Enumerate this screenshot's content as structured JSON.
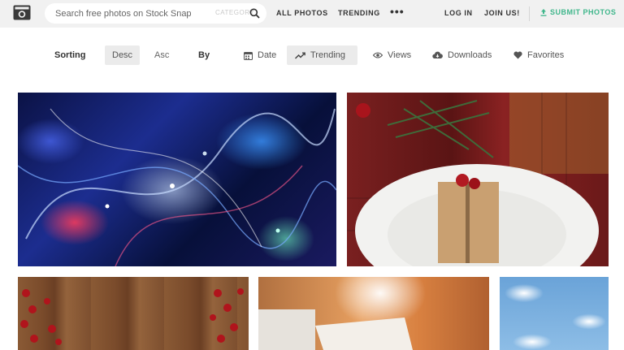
{
  "header": {
    "logo_icon": "camera-icon",
    "search": {
      "placeholder": "Search free photos on Stock Snap",
      "category_label": "CATEGORY"
    },
    "nav": {
      "all_photos": "ALL PHOTOS",
      "trending": "TRENDING",
      "more": "•••",
      "login": "LOG IN",
      "join": "JOIN US!",
      "submit": "SUBMIT PHOTOS"
    }
  },
  "sort": {
    "label": "Sorting",
    "desc": "Desc",
    "asc": "Asc",
    "by": "By",
    "options": [
      {
        "label": "Date",
        "icon": "calendar-icon"
      },
      {
        "label": "Trending",
        "icon": "trending-icon"
      },
      {
        "label": "Views",
        "icon": "eye-icon"
      },
      {
        "label": "Downloads",
        "icon": "cloud-download-icon"
      },
      {
        "label": "Favorites",
        "icon": "heart-icon"
      }
    ],
    "active_order": "Desc",
    "active_by": "Trending"
  },
  "photos": [
    {
      "subject": "abstract light trails"
    },
    {
      "subject": "gift box on plate with pine branch"
    },
    {
      "subject": "wooden boards with red berries"
    },
    {
      "subject": "sunlit paper"
    },
    {
      "subject": "sky with clouds"
    }
  ],
  "colors": {
    "header_bg": "#f1f1f1",
    "accent": "#3fb68b",
    "active_bg": "#ebebeb"
  }
}
